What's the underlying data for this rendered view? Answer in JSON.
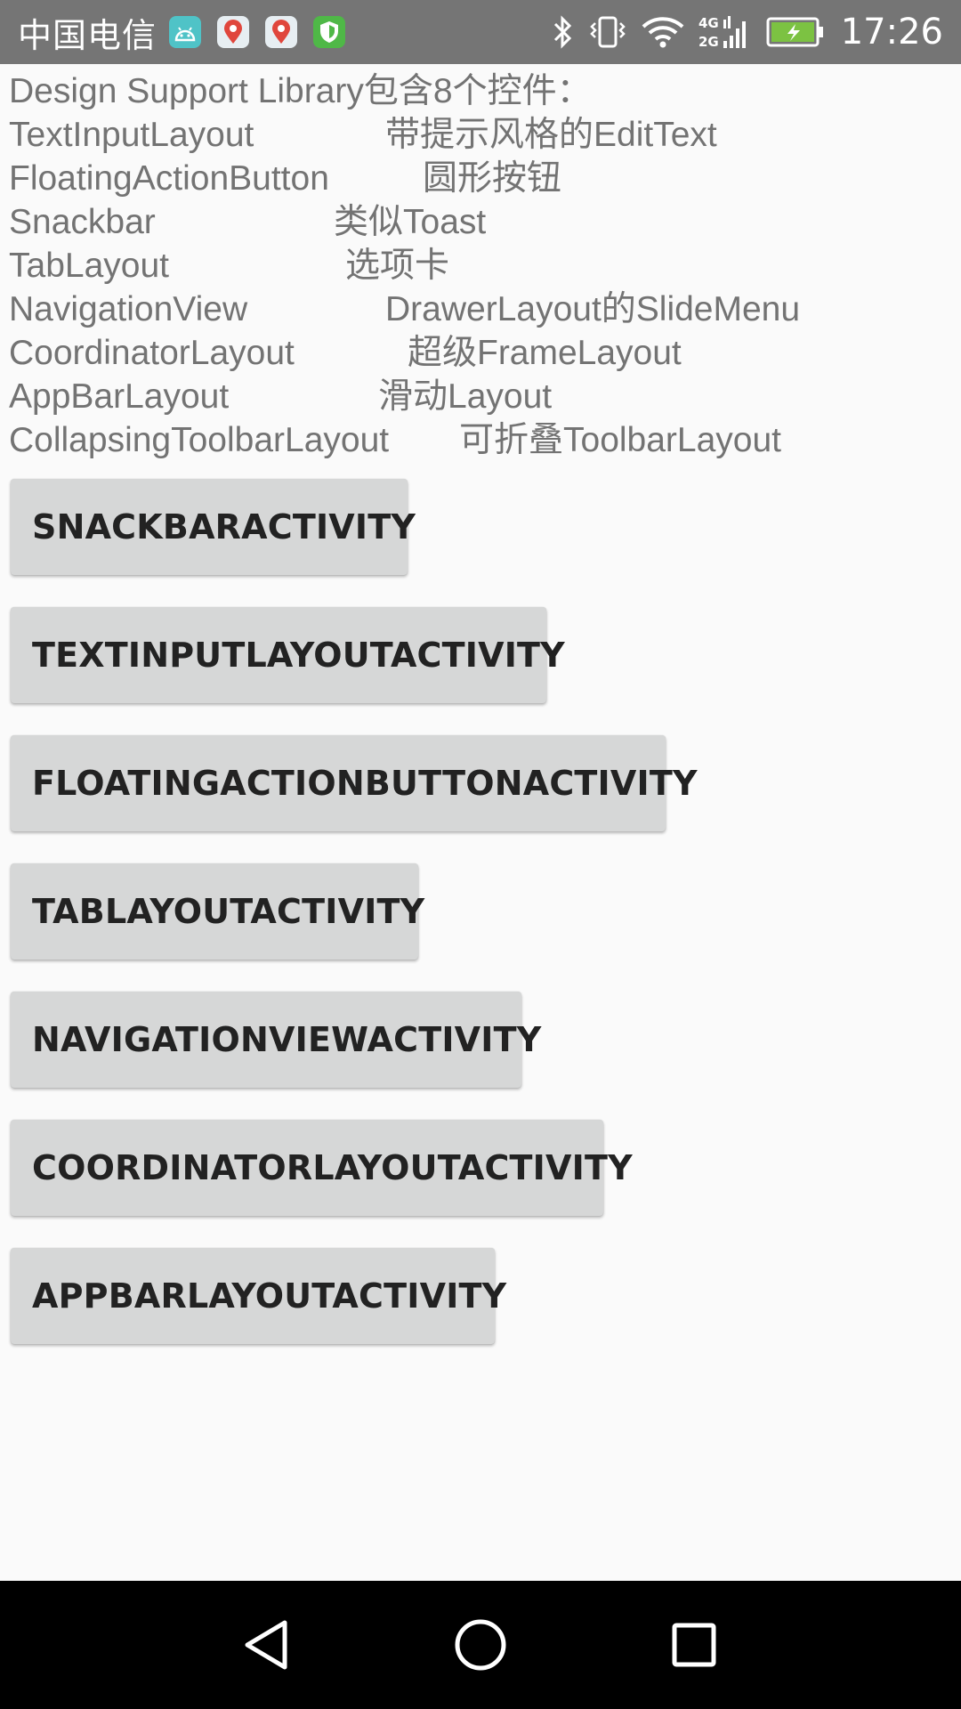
{
  "status_bar": {
    "carrier": "中国电信",
    "notification_icons": [
      "android-icon",
      "baidu-map-icon",
      "baidu-map-icon",
      "shield-icon"
    ],
    "network": "4G 2G",
    "time": "17:26"
  },
  "intro": {
    "title": "Design Support Library包含8个控件：",
    "rows": [
      {
        "name": "TextInputLayout",
        "desc": "带提示风格的EditText"
      },
      {
        "name": "FloatingActionButton",
        "desc": "圆形按钮"
      },
      {
        "name": "Snackbar",
        "desc": "类似Toast"
      },
      {
        "name": "TabLayout",
        "desc": "选项卡"
      },
      {
        "name": "NavigationView",
        "desc": "DrawerLayout的SlideMenu"
      },
      {
        "name": "CoordinatorLayout",
        "desc": "超级FrameLayout"
      },
      {
        "name": "AppBarLayout",
        "desc": "滑动Layout"
      },
      {
        "name": "CollapsingToolbarLayout",
        "desc": "可折叠ToolbarLayout"
      }
    ]
  },
  "buttons": [
    "SNACKBARACTIVITY",
    "TEXTINPUTLAYOUTACTIVITY",
    "FLOATINGACTIONBUTTONACTIVITY",
    "TABLAYOUTACTIVITY",
    "NAVIGATIONVIEWACTIVITY",
    "COORDINATORLAYOUTACTIVITY",
    "APPBARLAYOUTACTIVITY"
  ],
  "nav_bar": {
    "icons": [
      "back-icon",
      "home-icon",
      "recents-icon"
    ]
  },
  "colors": {
    "status_bar": "#757575",
    "background": "#fafafa",
    "intro_text": "#737373",
    "button": "#d6d7d7",
    "nav_bar": "#000000"
  }
}
